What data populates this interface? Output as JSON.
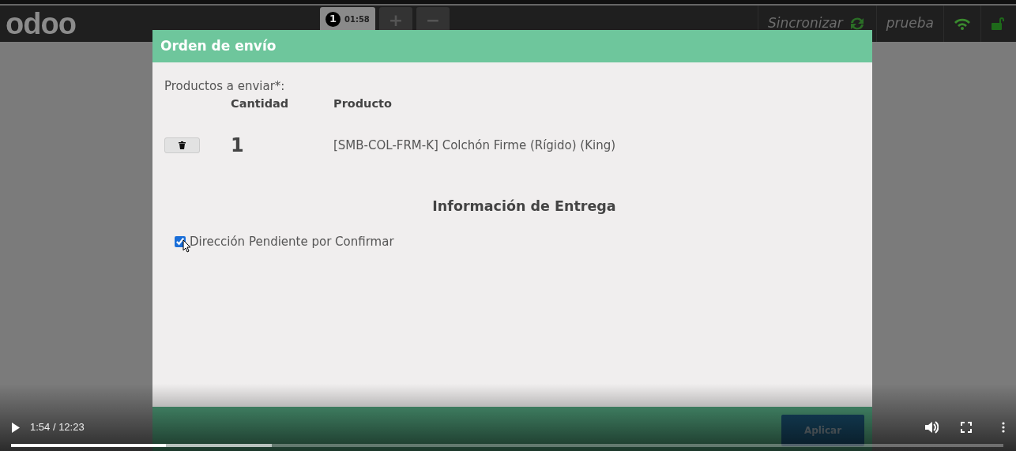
{
  "app": {
    "logo": "odoo",
    "order_tab": {
      "number": "1",
      "time": "01:58",
      "selected": true
    },
    "add_button": "+",
    "remove_button": "−",
    "sync_label": "Sincronizar",
    "user": "prueba"
  },
  "dialog": {
    "title": "Orden de envío",
    "products_label": "Productos a enviar*:",
    "columns": [
      "Cantidad",
      "Producto"
    ],
    "rows": [
      {
        "quantity": "1",
        "product": "[SMB-COL-FRM-K] Colchón Firme (Rígido) (King)"
      }
    ],
    "section_title": "Información de Entrega",
    "checkbox": {
      "label": "Dirección Pendiente por Confirmar",
      "checked": true
    },
    "apply_button": "Aplicar"
  },
  "video_player": {
    "time": "1:54 / 12:23",
    "progress": {
      "level": 0.156
    },
    "buffer": {
      "level": 0.263
    }
  }
}
